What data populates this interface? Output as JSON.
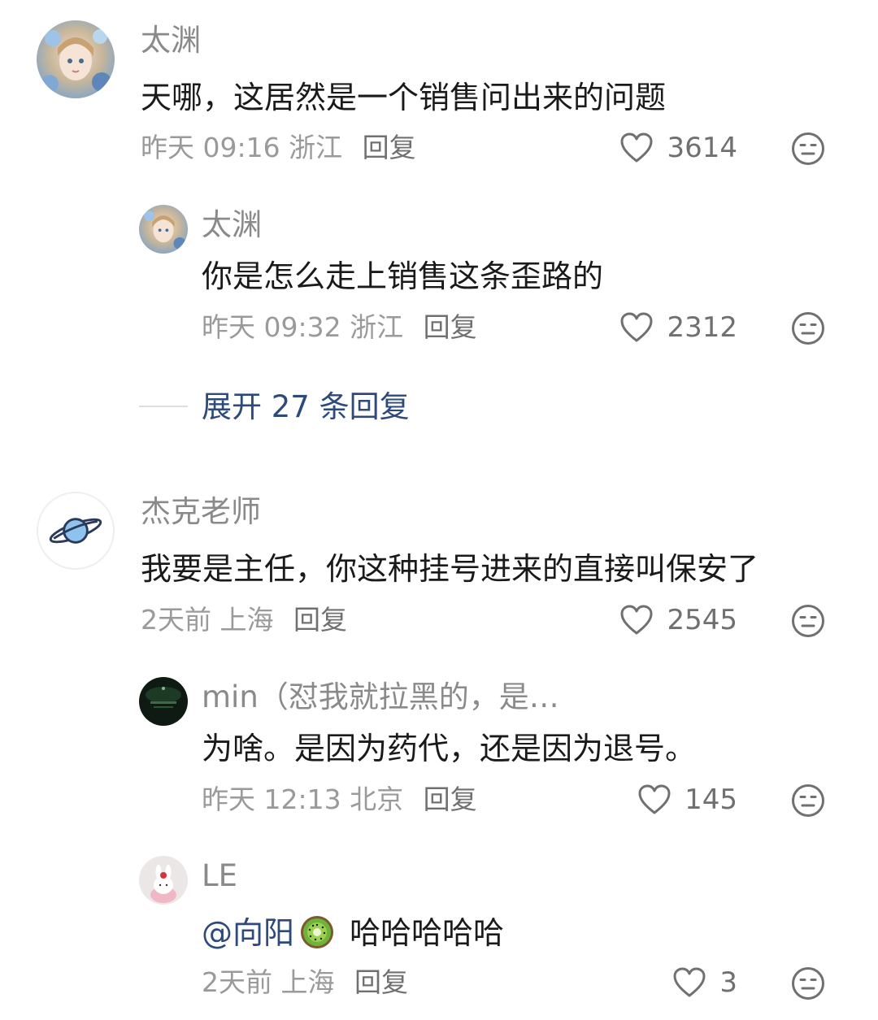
{
  "comments": [
    {
      "author": "太渊",
      "text": "天哪，这居然是一个销售问出来的问题",
      "time": "昨天 09:16",
      "location": "浙江",
      "reply_label": "回复",
      "likes": "3614"
    },
    {
      "author": "太渊",
      "text": "你是怎么走上销售这条歪路的",
      "time": "昨天 09:32",
      "location": "浙江",
      "reply_label": "回复",
      "likes": "2312"
    },
    {
      "author": "杰克老师",
      "text": "我要是主任，你这种挂号进来的直接叫保安了",
      "time": "2天前",
      "location": "上海",
      "reply_label": "回复",
      "likes": "2545"
    },
    {
      "author": "min（怼我就拉黑的，是…",
      "text": "为啥。是因为药代，还是因为退号。",
      "time": "昨天 12:13",
      "location": "北京",
      "reply_label": "回复",
      "likes": "145"
    },
    {
      "author": "LE",
      "mention": "@向阳",
      "text": "哈哈哈哈哈",
      "time": "2天前",
      "location": "上海",
      "reply_label": "回复",
      "likes": "3"
    }
  ],
  "expand_replies": "展开 27 条回复",
  "colors": {
    "link_blue": "#2d4a7a",
    "meta_gray": "#9a9a9a",
    "name_gray": "#8a8a8a"
  },
  "icons": [
    "heart-icon",
    "neutral-face-icon",
    "kiwi-emoji"
  ]
}
